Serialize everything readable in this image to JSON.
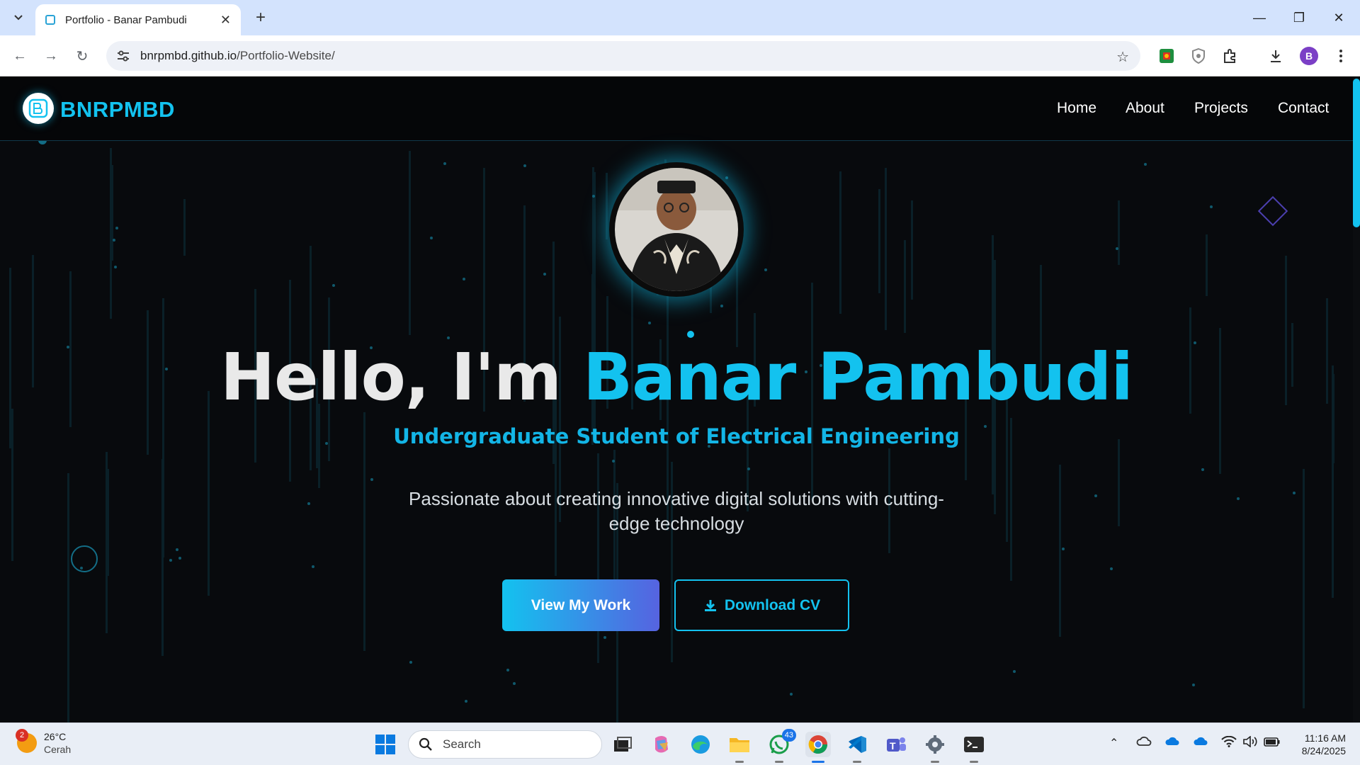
{
  "browser": {
    "tab_title": "Portfolio - Banar Pambudi",
    "url_host": "bnrpmbd.github.io",
    "url_path": "/Portfolio-Website/",
    "profile_initial": "B"
  },
  "site": {
    "logo_text": "BNRPMBD",
    "nav": [
      "Home",
      "About",
      "Projects",
      "Contact"
    ],
    "hero": {
      "greeting": "Hello, I'm ",
      "name": "Banar Pambudi",
      "subtitle": "Undergraduate Student of Electrical Engineering",
      "description": "Passionate about creating innovative digital solutions with cutting-edge technology",
      "primary_button": "View My Work",
      "secondary_button": "Download CV"
    },
    "colors": {
      "accent": "#13c2ef",
      "gradient_end": "#5663e0",
      "background": "#080a0d"
    }
  },
  "taskbar": {
    "weather_temp": "26°C",
    "weather_condition": "Cerah",
    "weather_badge": "2",
    "search_label": "Search",
    "whatsapp_badge": "43",
    "time": "11:16 AM",
    "date": "8/24/2025"
  }
}
